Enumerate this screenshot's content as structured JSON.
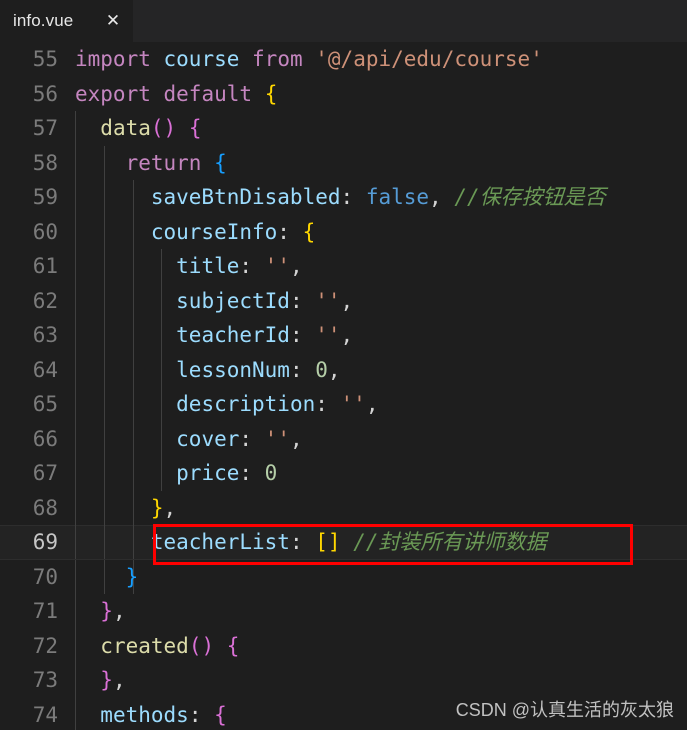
{
  "window": {
    "theme": "vscode-dark",
    "background": "#1e1e1e",
    "tabbar_background": "#252526"
  },
  "tabbar": {
    "tabs": [
      {
        "label": "info.vue",
        "active": true,
        "close_icon": "✕"
      }
    ]
  },
  "editor": {
    "first_line_number": 55,
    "language": "vue",
    "colors": {
      "keyword": "#c586c0",
      "keyword_constant": "#569cd6",
      "variable": "#9cdcfe",
      "string": "#ce9178",
      "number": "#b5cea8",
      "function": "#dcdcaa",
      "comment": "#6a9955",
      "punctuation": "#d4d4d4",
      "bracket_level_1": "#ffd700",
      "bracket_level_2": "#da70d6",
      "bracket_level_3": "#179fff",
      "line_number": "#7b7b7b",
      "line_number_active": "#c6c6c6",
      "indent_guide": "#404040",
      "active_line_background": "#232323",
      "annotation_box": "#ff0000"
    },
    "lines": [
      {
        "number": "55",
        "active": false,
        "guides": [],
        "tokens": [
          {
            "text": "import",
            "type": "kw"
          },
          {
            "text": " ",
            "type": "p"
          },
          {
            "text": "course",
            "type": "var"
          },
          {
            "text": " ",
            "type": "p"
          },
          {
            "text": "from",
            "type": "kw"
          },
          {
            "text": " ",
            "type": "p"
          },
          {
            "text": "'@/api/edu/course'",
            "type": "str"
          }
        ]
      },
      {
        "number": "56",
        "active": false,
        "guides": [],
        "tokens": [
          {
            "text": "export",
            "type": "kw"
          },
          {
            "text": " ",
            "type": "p"
          },
          {
            "text": "default",
            "type": "kw"
          },
          {
            "text": " ",
            "type": "p"
          },
          {
            "text": "{",
            "type": "br1"
          }
        ]
      },
      {
        "number": "57",
        "active": false,
        "guides": [
          75
        ],
        "tokens": [
          {
            "text": "  ",
            "type": "p"
          },
          {
            "text": "data",
            "type": "fn"
          },
          {
            "text": "()",
            "type": "br2"
          },
          {
            "text": " ",
            "type": "p"
          },
          {
            "text": "{",
            "type": "br2"
          }
        ]
      },
      {
        "number": "58",
        "active": false,
        "guides": [
          75,
          104
        ],
        "tokens": [
          {
            "text": "    ",
            "type": "p"
          },
          {
            "text": "return",
            "type": "kw"
          },
          {
            "text": " ",
            "type": "p"
          },
          {
            "text": "{",
            "type": "br3"
          }
        ]
      },
      {
        "number": "59",
        "active": false,
        "guides": [
          75,
          104,
          133
        ],
        "tokens": [
          {
            "text": "      ",
            "type": "p"
          },
          {
            "text": "saveBtnDisabled",
            "type": "var"
          },
          {
            "text": ": ",
            "type": "p"
          },
          {
            "text": "false",
            "type": "kw2"
          },
          {
            "text": ", ",
            "type": "p"
          },
          {
            "text": "//保存按钮是否",
            "type": "cmt"
          }
        ]
      },
      {
        "number": "60",
        "active": false,
        "guides": [
          75,
          104,
          133
        ],
        "tokens": [
          {
            "text": "      ",
            "type": "p"
          },
          {
            "text": "courseInfo",
            "type": "var"
          },
          {
            "text": ": ",
            "type": "p"
          },
          {
            "text": "{",
            "type": "br1"
          }
        ]
      },
      {
        "number": "61",
        "active": false,
        "guides": [
          75,
          104,
          133,
          161
        ],
        "tokens": [
          {
            "text": "        ",
            "type": "p"
          },
          {
            "text": "title",
            "type": "var"
          },
          {
            "text": ": ",
            "type": "p"
          },
          {
            "text": "''",
            "type": "str"
          },
          {
            "text": ",",
            "type": "p"
          }
        ]
      },
      {
        "number": "62",
        "active": false,
        "guides": [
          75,
          104,
          133,
          161
        ],
        "tokens": [
          {
            "text": "        ",
            "type": "p"
          },
          {
            "text": "subjectId",
            "type": "var"
          },
          {
            "text": ": ",
            "type": "p"
          },
          {
            "text": "''",
            "type": "str"
          },
          {
            "text": ",",
            "type": "p"
          }
        ]
      },
      {
        "number": "63",
        "active": false,
        "guides": [
          75,
          104,
          133,
          161
        ],
        "tokens": [
          {
            "text": "        ",
            "type": "p"
          },
          {
            "text": "teacherId",
            "type": "var"
          },
          {
            "text": ": ",
            "type": "p"
          },
          {
            "text": "''",
            "type": "str"
          },
          {
            "text": ",",
            "type": "p"
          }
        ]
      },
      {
        "number": "64",
        "active": false,
        "guides": [
          75,
          104,
          133,
          161
        ],
        "tokens": [
          {
            "text": "        ",
            "type": "p"
          },
          {
            "text": "lessonNum",
            "type": "var"
          },
          {
            "text": ": ",
            "type": "p"
          },
          {
            "text": "0",
            "type": "num"
          },
          {
            "text": ",",
            "type": "p"
          }
        ]
      },
      {
        "number": "65",
        "active": false,
        "guides": [
          75,
          104,
          133,
          161
        ],
        "tokens": [
          {
            "text": "        ",
            "type": "p"
          },
          {
            "text": "description",
            "type": "var"
          },
          {
            "text": ": ",
            "type": "p"
          },
          {
            "text": "''",
            "type": "str"
          },
          {
            "text": ",",
            "type": "p"
          }
        ]
      },
      {
        "number": "66",
        "active": false,
        "guides": [
          75,
          104,
          133,
          161
        ],
        "tokens": [
          {
            "text": "        ",
            "type": "p"
          },
          {
            "text": "cover",
            "type": "var"
          },
          {
            "text": ": ",
            "type": "p"
          },
          {
            "text": "''",
            "type": "str"
          },
          {
            "text": ",",
            "type": "p"
          }
        ]
      },
      {
        "number": "67",
        "active": false,
        "guides": [
          75,
          104,
          133,
          161
        ],
        "tokens": [
          {
            "text": "        ",
            "type": "p"
          },
          {
            "text": "price",
            "type": "var"
          },
          {
            "text": ": ",
            "type": "p"
          },
          {
            "text": "0",
            "type": "num"
          }
        ]
      },
      {
        "number": "68",
        "active": false,
        "guides": [
          75,
          104,
          133
        ],
        "tokens": [
          {
            "text": "      ",
            "type": "p"
          },
          {
            "text": "}",
            "type": "br1"
          },
          {
            "text": ",",
            "type": "p"
          }
        ]
      },
      {
        "number": "69",
        "active": true,
        "guides": [
          75,
          104,
          133
        ],
        "tokens": [
          {
            "text": "      ",
            "type": "p"
          },
          {
            "text": "teacherList",
            "type": "var"
          },
          {
            "text": ": ",
            "type": "p"
          },
          {
            "text": "[]",
            "type": "br1"
          },
          {
            "text": " ",
            "type": "p"
          },
          {
            "text": "//封装所有讲师数据",
            "type": "cmt"
          }
        ]
      },
      {
        "number": "70",
        "active": false,
        "guides": [
          75,
          104,
          133
        ],
        "tokens": [
          {
            "text": "    ",
            "type": "p"
          },
          {
            "text": "}",
            "type": "br3"
          }
        ]
      },
      {
        "number": "71",
        "active": false,
        "guides": [
          75
        ],
        "tokens": [
          {
            "text": "  ",
            "type": "p"
          },
          {
            "text": "}",
            "type": "br2"
          },
          {
            "text": ",",
            "type": "p"
          }
        ]
      },
      {
        "number": "72",
        "active": false,
        "guides": [
          75
        ],
        "tokens": [
          {
            "text": "  ",
            "type": "p"
          },
          {
            "text": "created",
            "type": "fn"
          },
          {
            "text": "()",
            "type": "br2"
          },
          {
            "text": " ",
            "type": "p"
          },
          {
            "text": "{",
            "type": "br2"
          }
        ]
      },
      {
        "number": "73",
        "active": false,
        "guides": [
          75
        ],
        "tokens": [
          {
            "text": "  ",
            "type": "p"
          },
          {
            "text": "}",
            "type": "br2"
          },
          {
            "text": ",",
            "type": "p"
          }
        ]
      },
      {
        "number": "74",
        "active": false,
        "guides": [
          75
        ],
        "tokens": [
          {
            "text": "  ",
            "type": "p"
          },
          {
            "text": "methods",
            "type": "var"
          },
          {
            "text": ": ",
            "type": "p"
          },
          {
            "text": "{",
            "type": "br2"
          }
        ]
      }
    ]
  },
  "annotation": {
    "type": "rectangle",
    "color": "#ff0000",
    "target_line": "69",
    "target_text": "teacherList: [] //封装所有讲师数据"
  },
  "watermark": {
    "text": "CSDN @认真生活的灰太狼"
  }
}
